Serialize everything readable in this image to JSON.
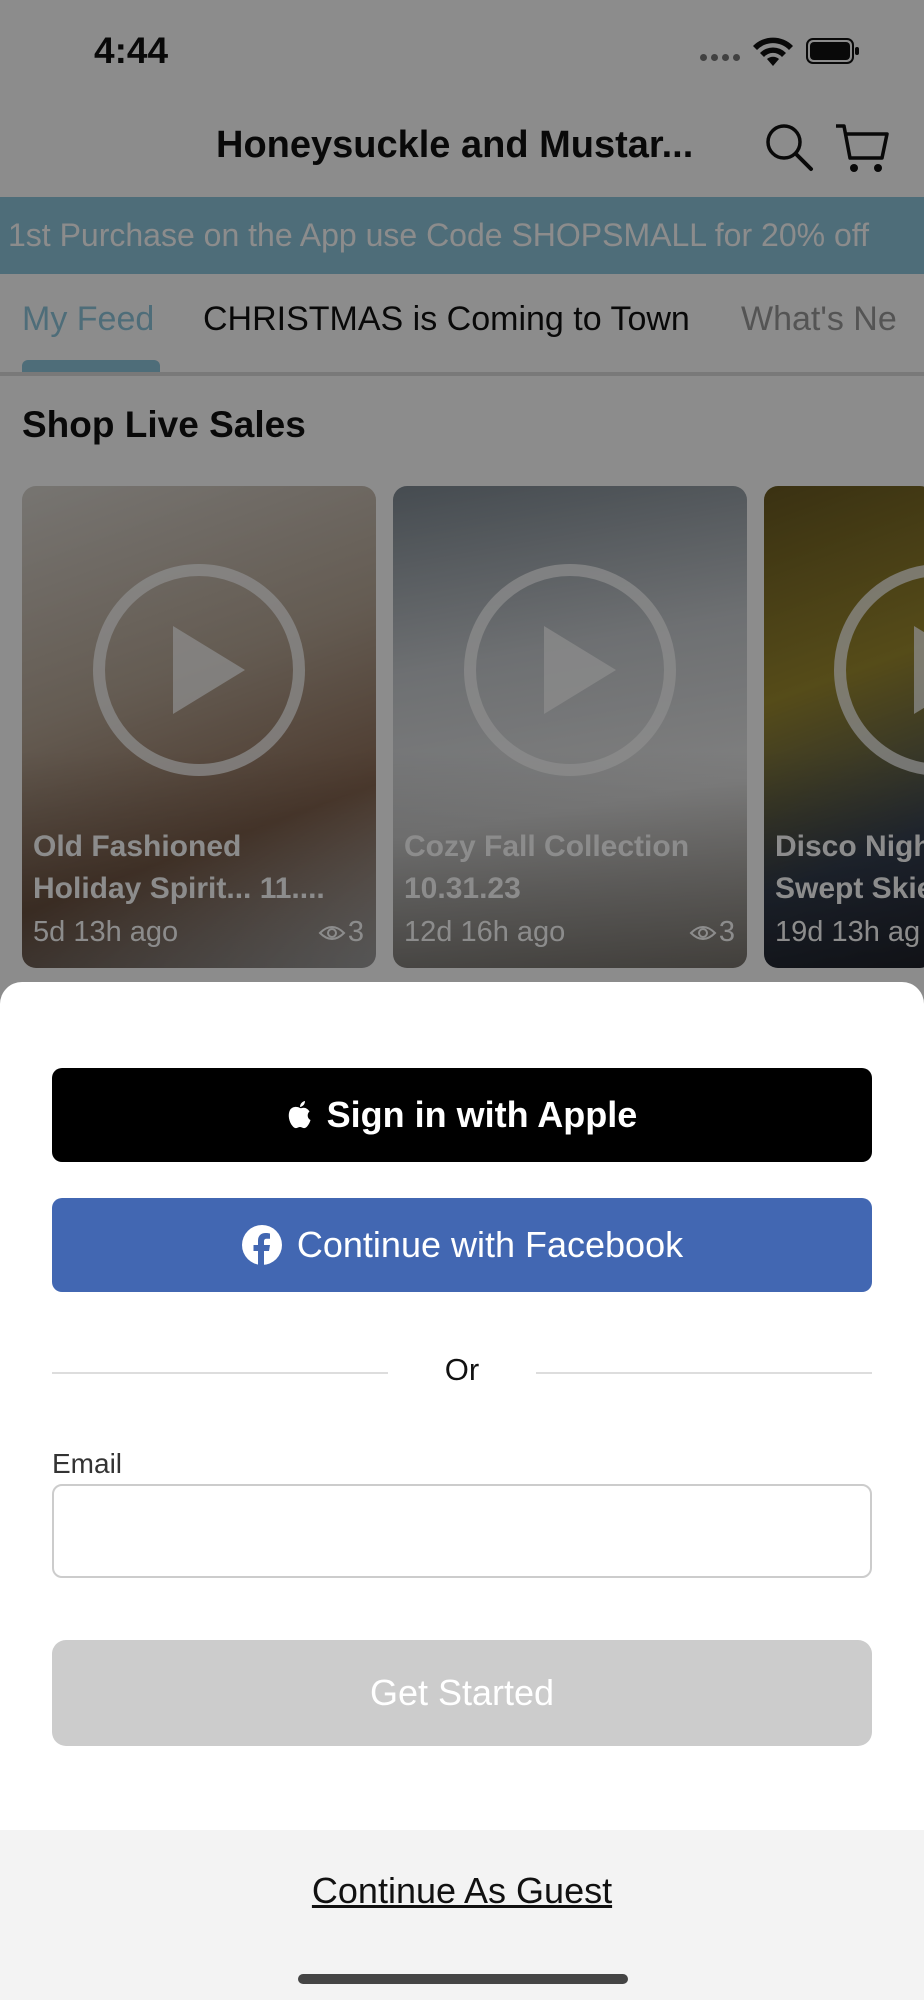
{
  "status_bar": {
    "time": "4:44"
  },
  "nav": {
    "title": "Honeysuckle and Mustar..."
  },
  "promo": {
    "text": "1st Purchase on the App use Code SHOPSMALL for 20% off"
  },
  "tabs": [
    {
      "label": "My Feed",
      "active": true
    },
    {
      "label": "CHRISTMAS is Coming to Town",
      "active": false
    },
    {
      "label": "What's Ne",
      "active": false
    }
  ],
  "section": {
    "title": "Shop Live Sales"
  },
  "cards": [
    {
      "title_line1": "Old Fashioned",
      "title_line2": "Holiday Spirit... 11....",
      "time": "5d 13h ago",
      "views": "3"
    },
    {
      "title_line1": "Cozy Fall Collection",
      "title_line2": "10.31.23",
      "time": "12d 16h ago",
      "views": "3"
    },
    {
      "title_line1": "Disco Nigh",
      "title_line2": "Swept Skie",
      "time": "19d 13h ag",
      "views": ""
    }
  ],
  "sheet": {
    "apple_label": "Sign in with Apple",
    "facebook_label": "Continue with Facebook",
    "or_label": "Or",
    "email_label": "Email",
    "email_value": "",
    "get_started_label": "Get Started",
    "guest_label": "Continue As Guest"
  },
  "colors": {
    "accent": "#8fc6dc",
    "facebook": "#4267b2",
    "apple": "#000000",
    "disabled": "#cccccc"
  },
  "icons": [
    "wifi-icon",
    "battery-icon",
    "search-icon",
    "cart-icon",
    "play-icon",
    "eye-icon",
    "apple-icon",
    "facebook-icon"
  ]
}
